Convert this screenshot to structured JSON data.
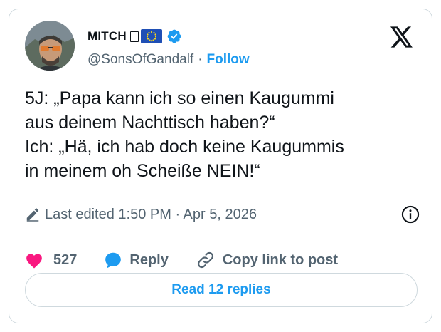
{
  "author": {
    "display_name": "MITCH",
    "handle": "@SonsOfGandalf",
    "follow_label": "Follow"
  },
  "tweet": {
    "text": "5J: „Papa kann ich so einen Kaugummi\naus deinem Nachttisch haben?“\nIch: „Hä, ich hab doch keine Kaugummis\nin meinem oh Scheiße NEIN!“",
    "edited_label": "Last edited 1:50 PM · Apr 5, 2026"
  },
  "actions": {
    "like_count": "527",
    "reply_label": "Reply",
    "copy_link_label": "Copy link to post"
  },
  "replies_button": "Read 12 replies",
  "colors": {
    "accent": "#1d9bf0",
    "like": "#f91880",
    "secondary_text": "#536471",
    "border": "#cfd9de"
  },
  "icons": [
    "x-logo-icon",
    "verified-badge-icon",
    "eu-flag-icon",
    "pencil-icon",
    "info-icon",
    "heart-icon",
    "reply-bubble-icon",
    "link-icon"
  ]
}
